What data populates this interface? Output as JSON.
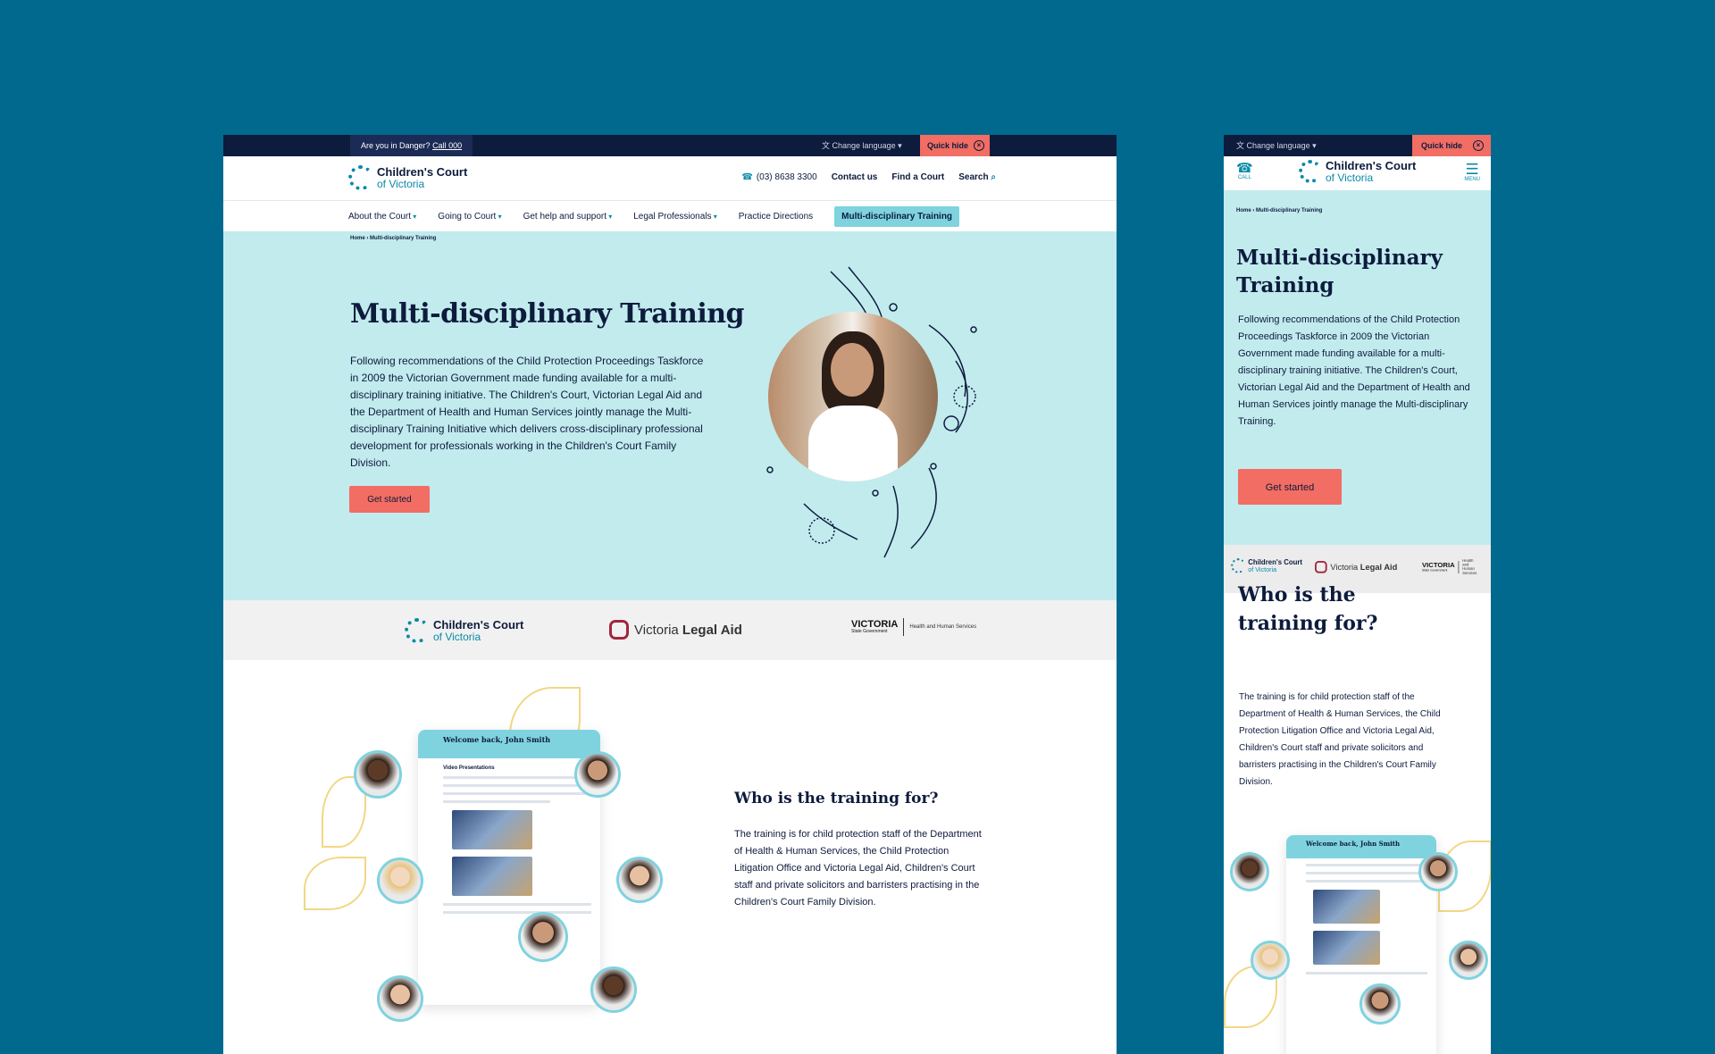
{
  "desktop": {
    "topbar": {
      "danger": "Are you in Danger?",
      "call": "Call 000",
      "language": "Change language",
      "quick_hide": "Quick hide"
    },
    "logo": {
      "line1": "Children's Court",
      "line2": "of Victoria"
    },
    "utility": {
      "phone": "(03) 8638 3300",
      "contact": "Contact us",
      "find": "Find a Court",
      "search": "Search"
    },
    "nav": [
      {
        "label": "About the Court"
      },
      {
        "label": "Going to Court"
      },
      {
        "label": "Get help and support"
      },
      {
        "label": "Legal Professionals"
      },
      {
        "label": "Practice Directions"
      },
      {
        "label": "Multi-disciplinary Training"
      }
    ],
    "breadcrumb": "Home › Multi-disciplinary Training",
    "hero": {
      "title": "Multi-disciplinary Training",
      "text": "Following recommendations of the Child Protection Proceedings Taskforce in 2009 the Victorian Government made funding available for a multi-disciplinary training initiative.  The Children's Court, Victorian Legal Aid and the Department of Health and Human Services jointly manage the Multi-disciplinary Training Initiative which delivers cross-disciplinary professional development for professionals working in the Children's Court Family Division.",
      "button": "Get started"
    },
    "partners": {
      "vla_light": "Victoria",
      "vla_bold": "Legal Aid",
      "vic_main": "VICTORIA",
      "vic_sub": "State Government",
      "vic_dept": "Health and Human Services"
    },
    "who": {
      "title": "Who is the training for?",
      "text": "The training is for child protection staff of the Department of Health & Human Services, the Child Protection Litigation Office and Victoria Legal Aid, Children's Court staff and private solicitors and barristers practising in the Children's Court Family Division.",
      "screen_heading": "Welcome back, John Smith",
      "screen_section": "Video Presentations"
    }
  },
  "mobile": {
    "language": "Change language",
    "quick_hide": "Quick hide",
    "call": "CALL",
    "menu": "MENU",
    "breadcrumb": "Home › Multi-disciplinary Training",
    "title": "Multi-disciplinary Training",
    "text": "Following recommendations of the Child Protection Proceedings Taskforce in 2009 the Victorian Government made funding available for a multi-disciplinary training initiative.  The Children's Court, Victorian Legal Aid and the Department of Health and Human Services jointly manage the Multi-disciplinary Training.",
    "button": "Get started",
    "who_title": "Who is the training for?",
    "who_text": "The training is for child protection staff of the Department of Health & Human Services, the Child Protection Litigation Office and Victoria Legal Aid,  Children's Court staff and private solicitors and barristers practising in the Children's Court Family Division."
  },
  "colors": {
    "background": "#02698e",
    "navy": "#0d1b3d",
    "teal_light": "#c2ebee",
    "teal_accent": "#7fd3df",
    "coral": "#f26d63"
  },
  "icons": [
    "phone-icon",
    "search-icon",
    "language-icon",
    "close-icon",
    "menu-icon"
  ]
}
